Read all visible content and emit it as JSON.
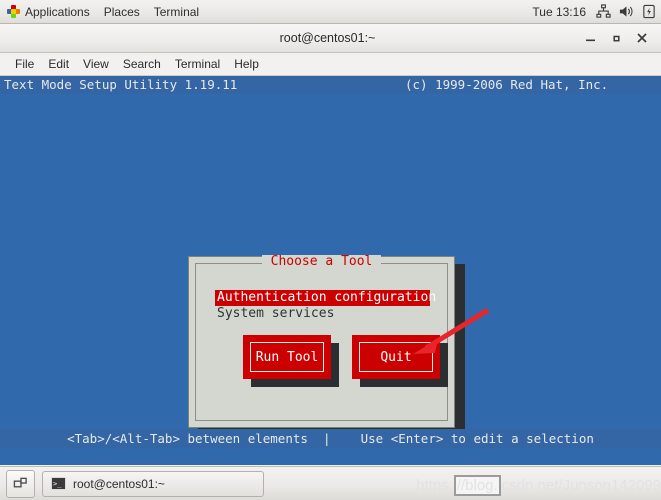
{
  "top_panel": {
    "apps_label": "Applications",
    "places_label": "Places",
    "terminal_label": "Terminal",
    "clock": "Tue 13:16",
    "tray": [
      {
        "icon": "network-icon"
      },
      {
        "icon": "volume-icon"
      },
      {
        "icon": "battery-icon"
      }
    ]
  },
  "window": {
    "title": "root@centos01:~",
    "controls": {
      "minimize": "–",
      "maximize": "■",
      "close": "×"
    },
    "menu": [
      "File",
      "Edit",
      "View",
      "Search",
      "Terminal",
      "Help"
    ]
  },
  "tui": {
    "header_title": "Text Mode Setup Utility 1.19.11",
    "header_copyright": "(c) 1999-2006 Red Hat, Inc.",
    "footer": "<Tab>/<Alt-Tab> between elements  |    Use <Enter> to edit a selection",
    "dialog": {
      "title": "Choose a Tool",
      "items": [
        {
          "label": "Authentication configuration",
          "selected": true
        },
        {
          "label": "System services",
          "selected": false
        }
      ],
      "buttons": [
        {
          "label": "Run Tool"
        },
        {
          "label": "Quit"
        }
      ]
    },
    "annotation": {
      "shape": "arrow",
      "color": "#e8252a",
      "points_to": "Quit"
    }
  },
  "taskbar": {
    "show_desktop_icon": "show-desktop-icon",
    "task_label": "root@centos01:~",
    "task_icon": "terminal-icon"
  },
  "watermark": {
    "part1": "https:",
    "cursor": "//blog.",
    "part2": "csdn.net/Junson142099"
  },
  "colors": {
    "terminal_bg": "#3069ac",
    "tui_bar": "#3465a4",
    "dialog_bg": "#d3d7cf",
    "accent_red": "#cc0000",
    "shadow": "#2b2f31",
    "annotation_red": "#e8252a"
  }
}
